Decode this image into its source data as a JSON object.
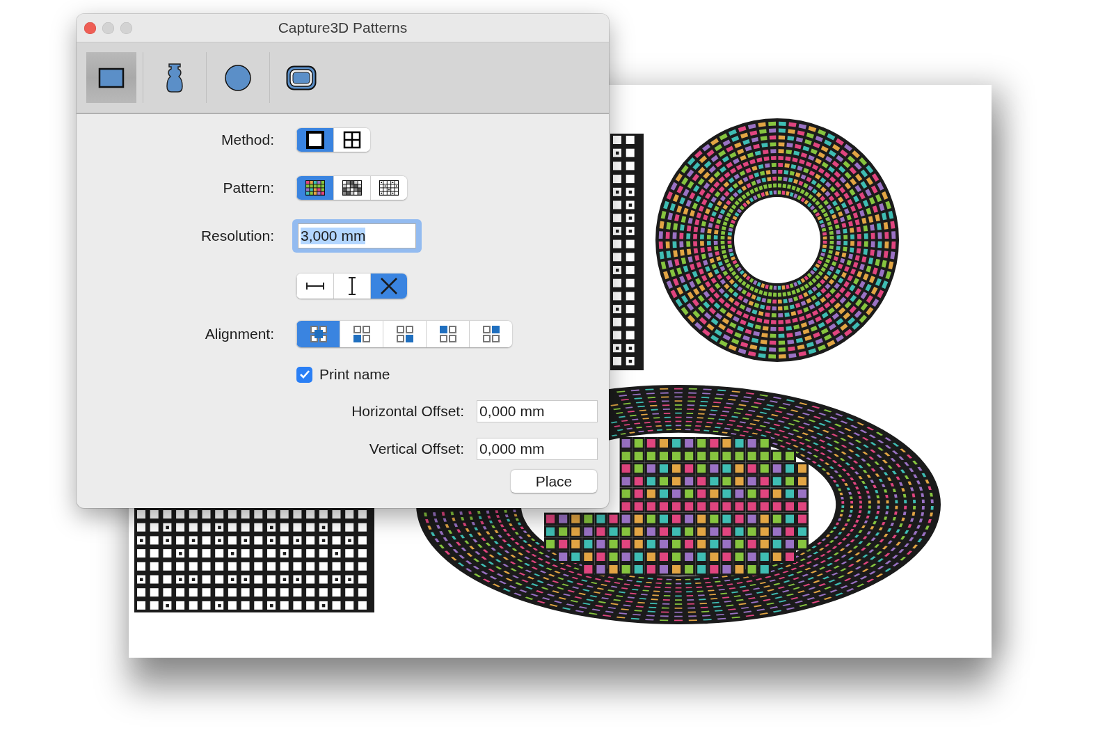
{
  "window": {
    "title": "Capture3D Patterns"
  },
  "toolbar": {
    "items": [
      {
        "kind": "rectangle",
        "selected": true
      },
      {
        "kind": "bottle",
        "selected": false
      },
      {
        "kind": "circle",
        "selected": false
      },
      {
        "kind": "rounded-frame",
        "selected": false
      }
    ]
  },
  "method": {
    "label": "Method:",
    "options": [
      {
        "kind": "single",
        "selected": true
      },
      {
        "kind": "quad",
        "selected": false
      }
    ]
  },
  "pattern": {
    "label": "Pattern:",
    "options": [
      {
        "kind": "color",
        "selected": true
      },
      {
        "kind": "gray",
        "selected": false
      },
      {
        "kind": "dots",
        "selected": false
      }
    ]
  },
  "resolution": {
    "label": "Resolution:",
    "value": "3,000 mm",
    "focused": true
  },
  "size_mode": {
    "options": [
      {
        "kind": "width",
        "selected": false
      },
      {
        "kind": "height",
        "selected": false
      },
      {
        "kind": "both",
        "selected": true
      }
    ]
  },
  "alignment": {
    "label": "Alignment:",
    "options": [
      {
        "kind": "center",
        "selected": true
      },
      {
        "kind": "bottom-left",
        "selected": false
      },
      {
        "kind": "bottom-right",
        "selected": false
      },
      {
        "kind": "top-left",
        "selected": false
      },
      {
        "kind": "top-right",
        "selected": false
      }
    ]
  },
  "print_name": {
    "label": "Print name",
    "checked": true
  },
  "offsets": [
    {
      "label": "Horizontal Offset:",
      "value": "0,000 mm"
    },
    {
      "label": "Vertical Offset:",
      "value": "0,000 mm"
    }
  ],
  "buttons": [
    {
      "label": "Place"
    }
  ]
}
